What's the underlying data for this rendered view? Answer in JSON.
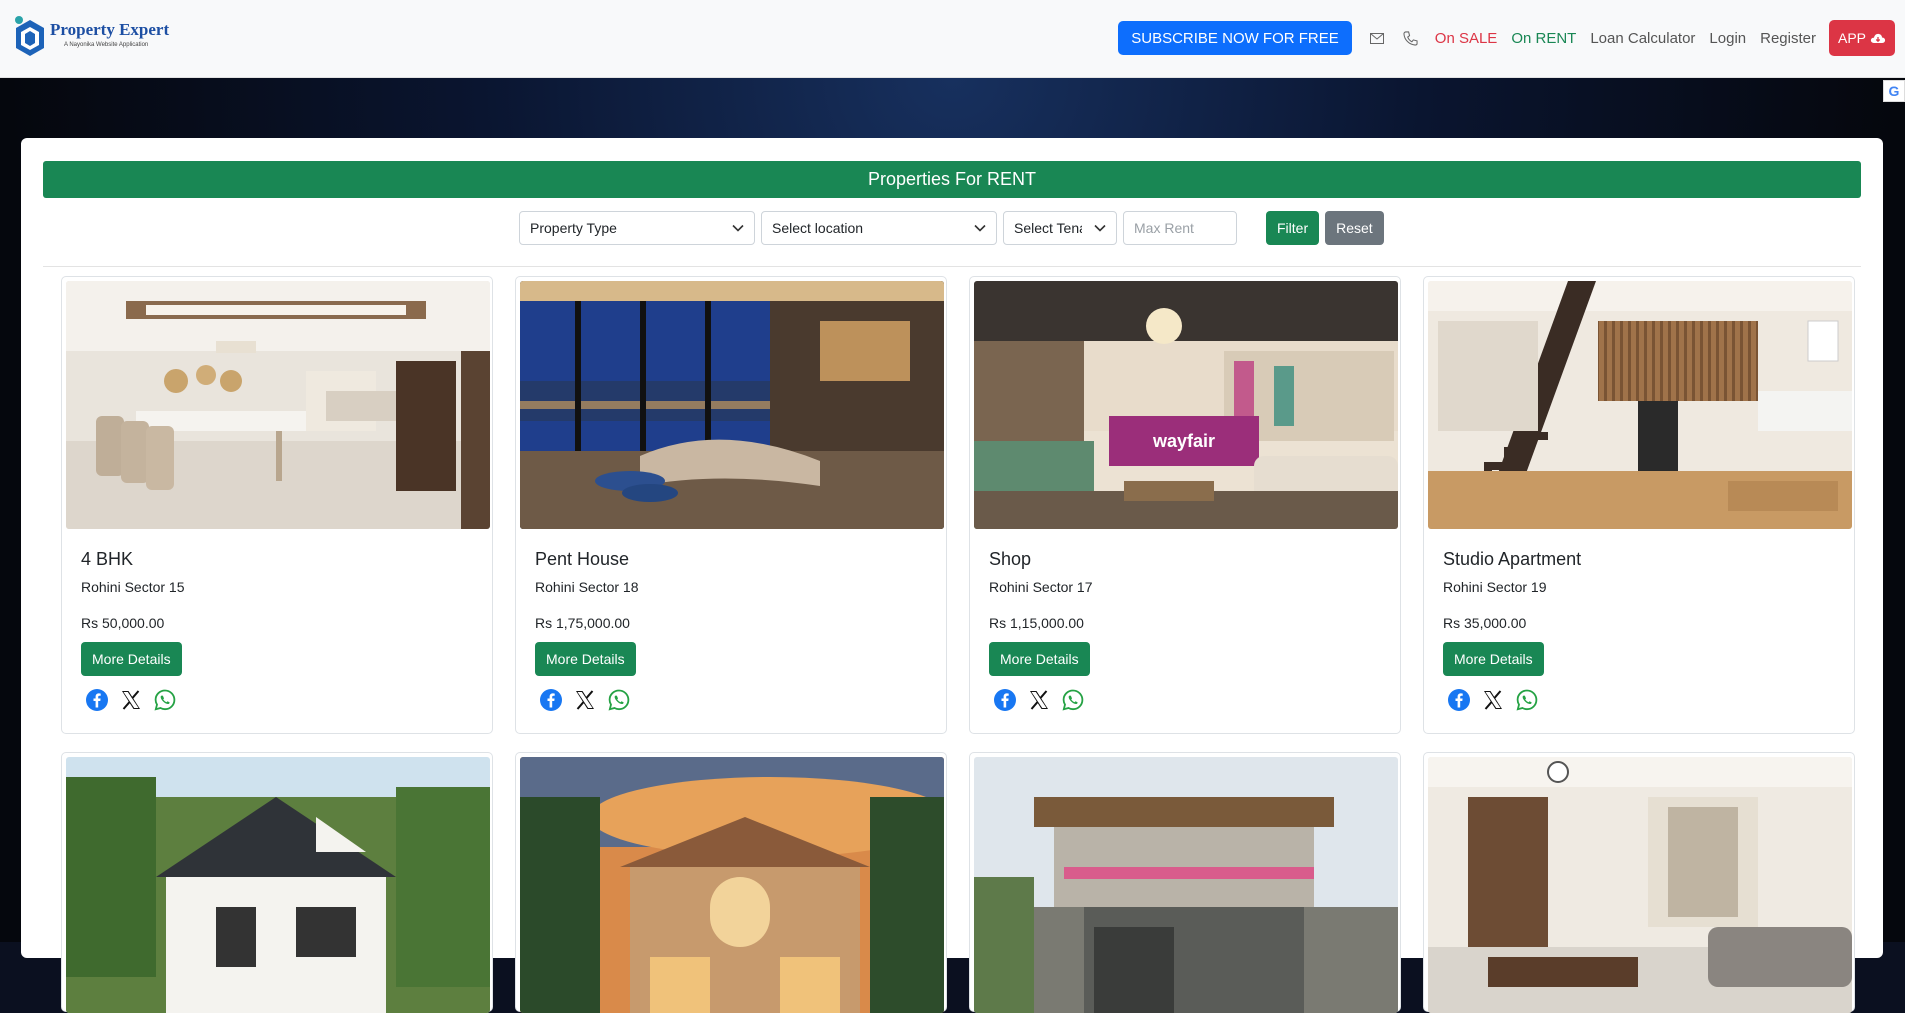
{
  "brand": {
    "name": "Property Expert",
    "tagline": "A Nayonika Website Application"
  },
  "nav": {
    "subscribe_label": "SUBSCRIBE NOW FOR FREE",
    "links": {
      "on_sale": "On SALE",
      "on_rent": "On RENT",
      "loan_calculator": "Loan Calculator",
      "login": "Login",
      "register": "Register"
    },
    "app_label": "APP"
  },
  "translate_badge": "G",
  "section": {
    "title": "Properties For RENT"
  },
  "filters": {
    "property_type": "Property Type",
    "location": "Select location",
    "tenant": "Select Tenant",
    "max_rent_placeholder": "Max Rent",
    "filter_label": "Filter",
    "reset_label": "Reset"
  },
  "properties": [
    {
      "title": "4 BHK",
      "location": "Rohini Sector 15",
      "price": "Rs 50,000.00",
      "button": "More Details"
    },
    {
      "title": "Pent House",
      "location": "Rohini Sector 18",
      "price": "Rs 1,75,000.00",
      "button": "More Details"
    },
    {
      "title": "Shop",
      "location": "Rohini Sector 17",
      "price": "Rs 1,15,000.00",
      "button": "More Details",
      "image_sign": "wayfair"
    },
    {
      "title": "Studio Apartment",
      "location": "Rohini Sector 19",
      "price": "Rs 35,000.00",
      "button": "More Details"
    }
  ],
  "colors": {
    "primary": "#0d6efd",
    "success": "#198754",
    "danger": "#dc3545",
    "secondary": "#6c757d"
  }
}
